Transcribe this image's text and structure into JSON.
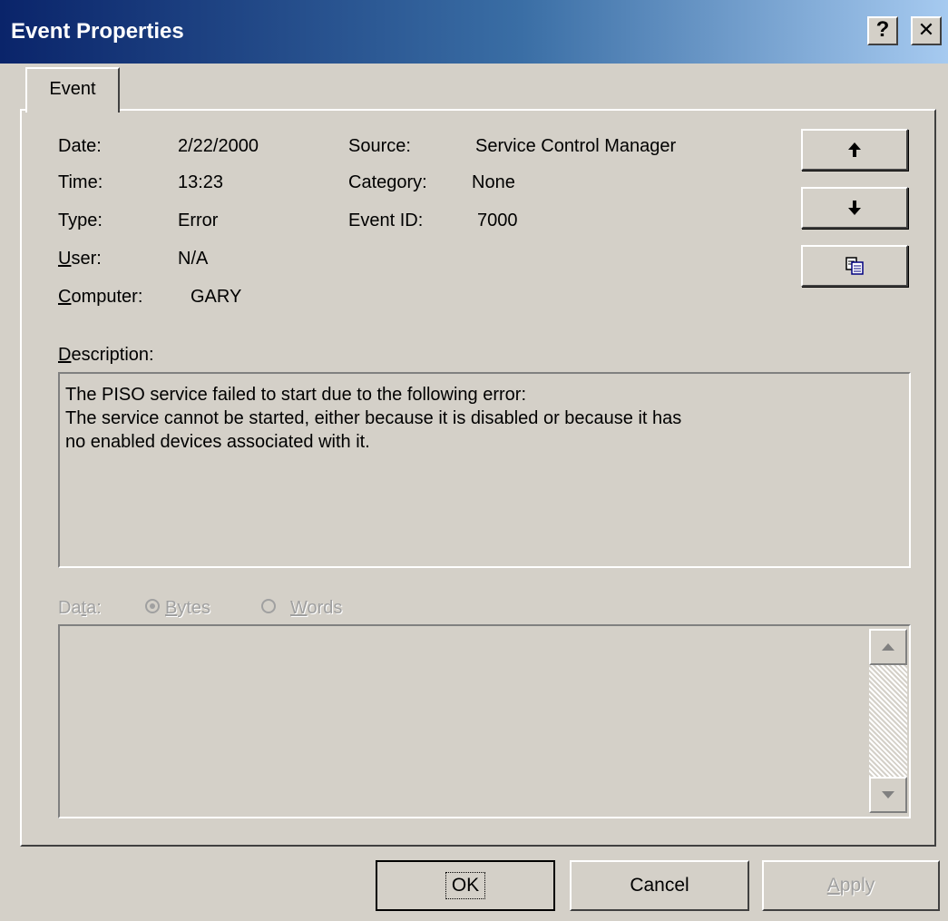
{
  "window": {
    "title": "Event Properties",
    "help_glyph": "?",
    "close_glyph": "✕"
  },
  "tab": {
    "label": "Event"
  },
  "fields": {
    "date_label": "Date:",
    "date_value": "2/22/2000",
    "time_label": "Time:",
    "time_value": "13:23",
    "type_label": "Type:",
    "type_value": "Error",
    "user_label_pre": "U",
    "user_label_rest": "ser:",
    "user_value": "N/A",
    "computer_label_pre": "C",
    "computer_label_rest": "omputer:",
    "computer_value": "GARY",
    "source_label": "Source:",
    "source_value": "Service Control Manager",
    "category_label": "Category:",
    "category_value": "None",
    "eventid_label": "Event ID:",
    "eventid_value": "7000"
  },
  "description": {
    "label_pre": "D",
    "label_rest": "escription:",
    "line1": "The PISO service failed to start due to the following error:",
    "line2": "The service cannot be started, either because it is disabled or because it has",
    "line3": "no enabled devices associated with it."
  },
  "data_section": {
    "label_pre": "Da",
    "label_u": "t",
    "label_rest": "a:",
    "bytes_u": "B",
    "bytes_rest": "ytes",
    "words_u": "W",
    "words_rest": "ords",
    "selected": "bytes"
  },
  "buttons": {
    "ok": "OK",
    "cancel": "Cancel",
    "apply_u": "A",
    "apply_rest": "pply"
  },
  "icons": {
    "prev": "arrow-up-icon",
    "next": "arrow-down-icon",
    "copy": "copy-icon"
  },
  "colors": {
    "title_start": "#0a246a",
    "title_end": "#a6caf0",
    "face": "#d4d0c8"
  }
}
